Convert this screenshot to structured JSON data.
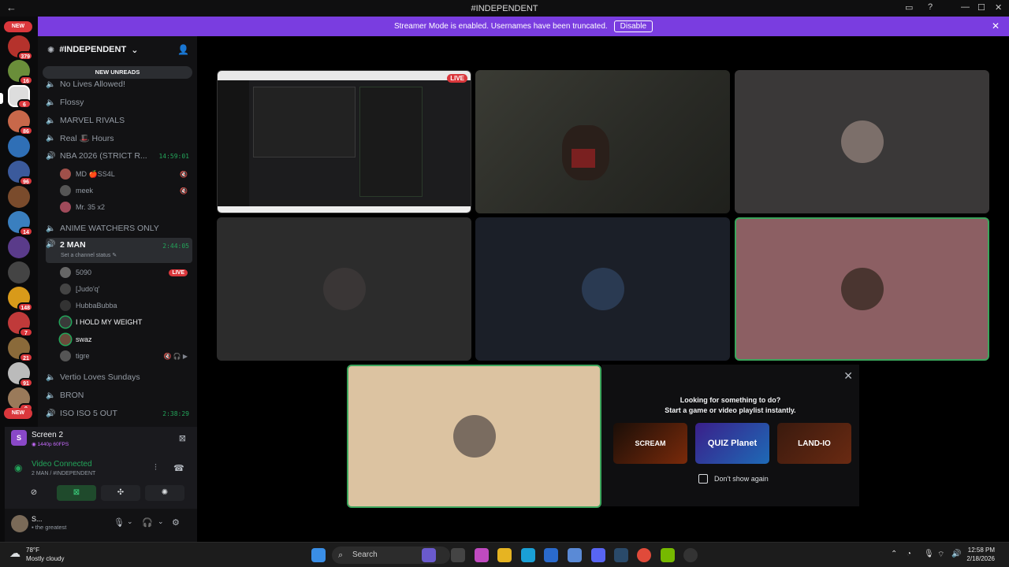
{
  "window": {
    "title": "#INDEPENDENT"
  },
  "banner": {
    "text": "Streamer Mode is enabled. Usernames have been truncated.",
    "button": "Disable"
  },
  "rail": {
    "badges": [
      "NEW",
      "379",
      "16",
      "6",
      "86",
      "96",
      "14",
      "148",
      "7",
      "21",
      "91",
      "9",
      "NEW"
    ]
  },
  "server": {
    "name": "#INDEPENDENT"
  },
  "new_unreads": "NEW UNREADS",
  "channels": [
    {
      "name": "No Lives Allowed!"
    },
    {
      "name": "Flossy"
    },
    {
      "name": "MARVEL RIVALS"
    },
    {
      "name": "Real 🎩 Hours"
    },
    {
      "name": "NBA 2026 (STRICT R...",
      "time": "14:59:01"
    },
    {
      "name": "ANIME WATCHERS ONLY"
    },
    {
      "name": "2 MAN",
      "time": "2:44:05",
      "status": "Set a channel status ✎"
    },
    {
      "name": "Vertio Loves Sundays"
    },
    {
      "name": "BRON"
    },
    {
      "name": "ISO ISO 5 OUT",
      "time": "2:38:29"
    }
  ],
  "nba_users": [
    "MD 🍎SS4L",
    "meek",
    "Mr. 35 x2"
  ],
  "twoman_users": [
    "5090",
    "[Judo'q'",
    "HubbaBubba",
    "I HOLD MY WEIGHT",
    "swaz",
    "tigre"
  ],
  "live_label": "LIVE",
  "voice": {
    "screen_name": "Screen 2",
    "screen_sub": "◉ 1440p 60FPS",
    "status": "Video Connected",
    "location": "2 MAN / #INDEPENDENT"
  },
  "userbar": {
    "name": "S...",
    "status": "▪ the greatest"
  },
  "tiles": {
    "live_label": "LIVE"
  },
  "activity": {
    "line1": "Looking for something to do?",
    "line2": "Start a game or video playlist instantly.",
    "games": [
      "SCREAM",
      "QUIZ Planet",
      "LAND-IO"
    ],
    "dont_show": "Don't show again"
  },
  "taskbar": {
    "temp": "78°F",
    "weather": "Mostly cloudy",
    "search": "Search",
    "time": "12:58 PM",
    "date": "2/18/2026"
  }
}
